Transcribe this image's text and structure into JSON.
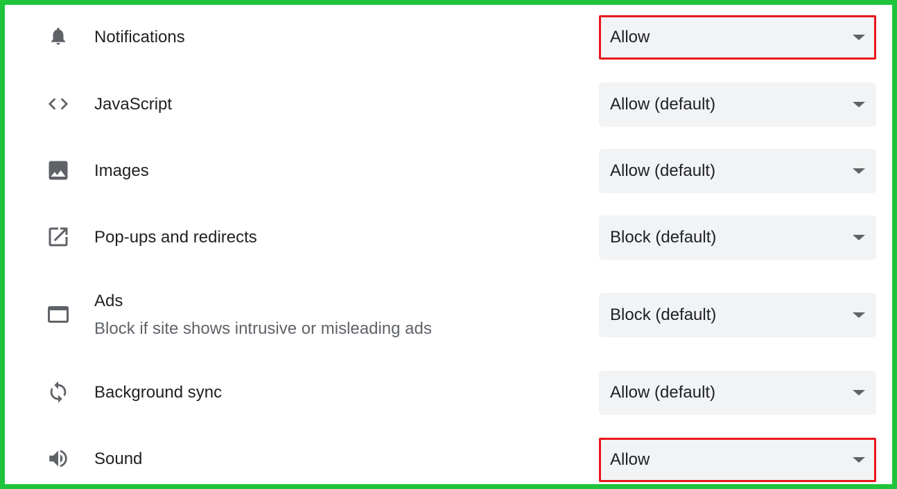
{
  "colors": {
    "frame_border": "#1ec43a",
    "highlight_border": "#e8161c",
    "select_background": "#f1f3f4"
  },
  "settings": [
    {
      "icon": "bell-icon",
      "label": "Notifications",
      "value": "Allow"
    },
    {
      "icon": "code-icon",
      "label": "JavaScript",
      "value": "Allow (default)"
    },
    {
      "icon": "image-icon",
      "label": "Images",
      "value": "Allow (default)"
    },
    {
      "icon": "open-in-new-icon",
      "label": "Pop-ups and redirects",
      "value": "Block (default)"
    },
    {
      "icon": "web-window-icon",
      "label": "Ads",
      "sublabel": "Block if site shows intrusive or misleading ads",
      "value": "Block (default)"
    },
    {
      "icon": "sync-icon",
      "label": "Background sync",
      "value": "Allow (default)"
    },
    {
      "icon": "volume-icon",
      "label": "Sound",
      "value": "Allow"
    }
  ]
}
